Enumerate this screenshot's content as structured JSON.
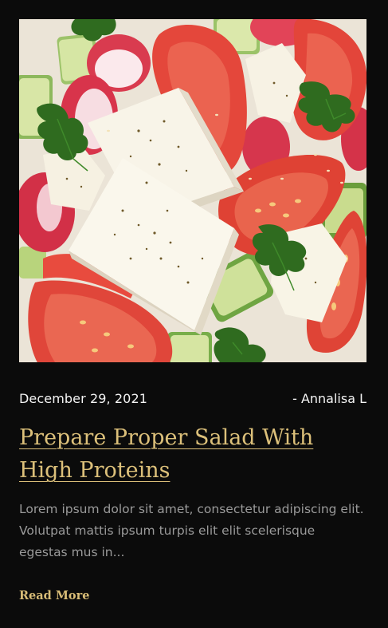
{
  "post": {
    "image_alt": "Salad with feta cheese, tomatoes, radish, cucumber and parsley",
    "date": "December 29, 2021",
    "author": "- Annalisa L",
    "title": "Prepare Proper Salad With High Proteins",
    "excerpt": "Lorem ipsum dolor sit amet, consectetur adipiscing elit. Volutpat mattis ipsum turpis elit elit scelerisque egestas mus in...",
    "read_more": "Read More"
  },
  "colors": {
    "background": "#0b0b0b",
    "title_gold": "#dcc07a",
    "read_more_gold": "#d9bd77",
    "meta_text": "#f4f4f4",
    "excerpt_text": "#9a9a9a"
  }
}
